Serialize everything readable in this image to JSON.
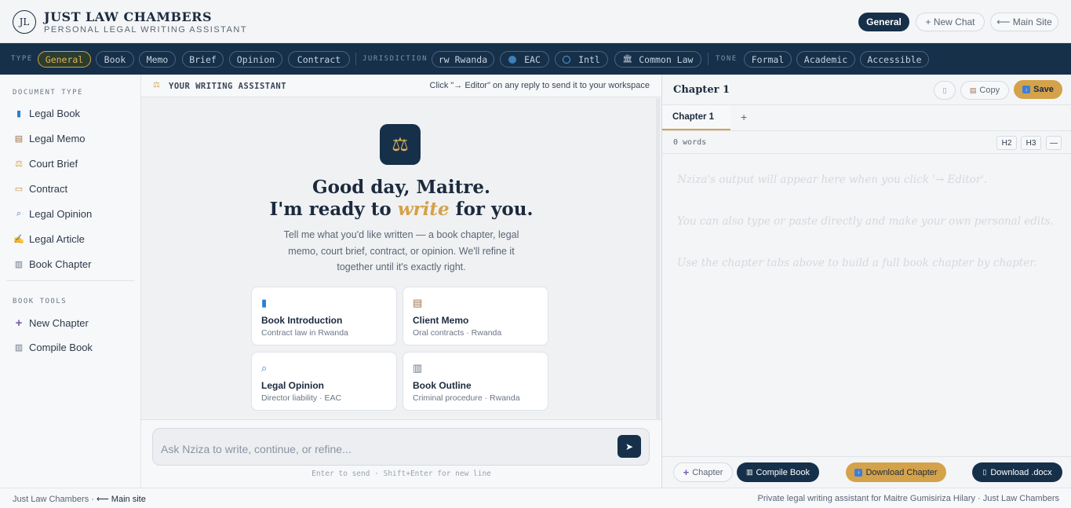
{
  "header": {
    "logo": "JL",
    "title": "JUST LAW CHAMBERS",
    "subtitle": "PERSONAL LEGAL WRITING ASSISTANT",
    "mode_button": "General",
    "new_chat": "+ New Chat",
    "main_site": "⟵ Main Site"
  },
  "toolbar": {
    "type_label": "TYPE",
    "types": [
      "General",
      "Book",
      "Memo",
      "Brief",
      "Opinion",
      "Contract"
    ],
    "jurisdiction_label": "JURISDICTION",
    "jurisdictions": [
      "rw Rwanda",
      "EAC",
      "Intl",
      "Common Law"
    ],
    "tone_label": "TONE",
    "tones": [
      "Formal",
      "Academic",
      "Accessible"
    ],
    "selected_type": "General"
  },
  "sidebar": {
    "doc_type_label": "DOCUMENT TYPE",
    "doc_types": [
      "Legal Book",
      "Legal Memo",
      "Court Brief",
      "Contract",
      "Legal Opinion",
      "Legal Article",
      "Book Chapter"
    ],
    "tools_label": "BOOK TOOLS",
    "tools": [
      "New Chapter",
      "Compile Book"
    ]
  },
  "chat": {
    "header_title": "YOUR WRITING ASSISTANT",
    "header_hint": "Click \"→ Editor\" on any reply to send it to your workspace",
    "greeting_line1": "Good day, Maitre.",
    "greeting_pre": "I'm ready to ",
    "greeting_em": "write",
    "greeting_post": " for you.",
    "intro_line1": "Tell me what you'd like written — a book chapter, legal",
    "intro_line2": "memo, court brief, contract, or opinion. We'll refine it",
    "intro_line3": "together until it's exactly right.",
    "cards": [
      {
        "title": "Book Introduction",
        "sub": "Contract law in Rwanda",
        "icon": "book-icon"
      },
      {
        "title": "Client Memo",
        "sub": "Oral contracts · Rwanda",
        "icon": "memo-icon"
      },
      {
        "title": "Legal Opinion",
        "sub": "Director liability · EAC",
        "icon": "magnifier-icon"
      },
      {
        "title": "Book Outline",
        "sub": "Criminal procedure · Rwanda",
        "icon": "open-book-icon"
      }
    ],
    "input_placeholder": "Ask Nziza to write, continue, or refine...",
    "input_hint": "Enter to send · Shift+Enter for new line"
  },
  "editor": {
    "title": "Chapter 1",
    "copy": "Copy",
    "save": "Save",
    "tab": "Chapter 1",
    "add_tab": "+",
    "word_count": "0 words",
    "h2": "H2",
    "h3": "H3",
    "rule": "—",
    "placeholder_1": "Nziza's output will appear here when you click '→ Editor'.",
    "placeholder_2": "You can also type or paste directly and make your own personal edits.",
    "placeholder_3": "Use the chapter tabs above to build a full book chapter by chapter.",
    "btn_chapter": "Chapter",
    "btn_compile": "Compile Book",
    "btn_download_chapter": "Download Chapter",
    "btn_download_docx": "Download .docx"
  },
  "footer": {
    "left_text": "Just Law Chambers · ",
    "left_link": "⟵ Main site",
    "right_text": "Private legal writing assistant for Maitre Gumisiriza Hilary · Just Law Chambers"
  },
  "colors": {
    "navy": "#16304a",
    "gold": "#d4a24a",
    "background": "#f4f5f7"
  }
}
